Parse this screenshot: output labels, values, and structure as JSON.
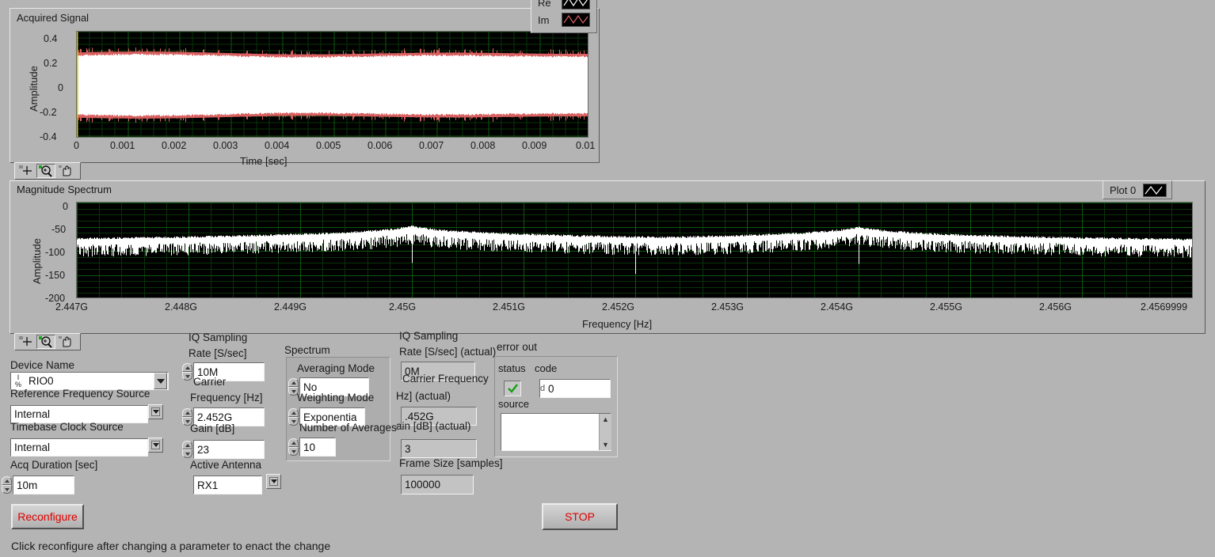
{
  "signal_graph": {
    "title": "Acquired Signal",
    "y_title": "Amplitude",
    "x_title": "Time [sec]",
    "y_ticks": [
      "0.4",
      "0.2",
      "0",
      "-0.2",
      "-0.4"
    ],
    "x_ticks": [
      "0",
      "0.001",
      "0.002",
      "0.003",
      "0.004",
      "0.005",
      "0.006",
      "0.007",
      "0.008",
      "0.009",
      "0.01"
    ],
    "legend": [
      {
        "name": "Re",
        "color": "#ffffff"
      },
      {
        "name": "Im",
        "color": "#d86060"
      }
    ]
  },
  "spectrum_graph": {
    "title": "Magnitude Spectrum",
    "y_title": "Amplitude",
    "x_title": "Frequency [Hz]",
    "y_ticks": [
      "0",
      "-50",
      "-100",
      "-150",
      "-200"
    ],
    "x_ticks": [
      "2.447G",
      "2.448G",
      "2.449G",
      "2.45G",
      "2.451G",
      "2.452G",
      "2.453G",
      "2.454G",
      "2.455G",
      "2.456G",
      "2.4569999"
    ],
    "legend": [
      {
        "name": "Plot 0",
        "color": "#ffffff"
      }
    ]
  },
  "chart_data": {
    "type": "line",
    "title": "Magnitude Spectrum",
    "xlabel": "Frequency [Hz]",
    "ylabel": "Amplitude",
    "xlim": [
      2447000000.0,
      2456999900.0
    ],
    "ylim": [
      -200,
      0
    ],
    "grid": true,
    "legend_position": "top-right",
    "series": [
      {
        "name": "Plot 0",
        "color": "#ffffff",
        "noise_floor_db": -130,
        "peaks": [
          {
            "freq": 2450000000.0,
            "level_db": -55
          },
          {
            "freq": 2452000000.0,
            "level_db": -78
          },
          {
            "freq": 2454000000.0,
            "level_db": -57
          }
        ]
      }
    ],
    "secondary_chart": {
      "type": "line",
      "title": "Acquired Signal",
      "xlabel": "Time [sec]",
      "ylabel": "Amplitude",
      "xlim": [
        0,
        0.01
      ],
      "ylim": [
        -0.4,
        0.4
      ],
      "series": [
        {
          "name": "Re",
          "color": "#ffffff",
          "envelope": [
            -0.23,
            0.23
          ]
        },
        {
          "name": "Im",
          "color": "#d86060",
          "envelope": [
            -0.26,
            0.26
          ]
        }
      ]
    }
  },
  "tools": {
    "cursor": "crosshair-cursor-tool",
    "zoom": "zoom-tool",
    "pan": "pan-hand-tool"
  },
  "controls": {
    "device_name": {
      "label": "Device Name",
      "value": "RIO0"
    },
    "ref_freq_source": {
      "label": "Reference Frequency Source",
      "value": "Internal"
    },
    "timebase_clock_source": {
      "label": "Timebase Clock Source",
      "value": "Internal"
    },
    "acq_duration": {
      "label": "Acq Duration [sec]",
      "value": "10m"
    },
    "iq_rate": {
      "label_line1": "IQ Sampling",
      "label_line2": "Rate [S/sec]",
      "value": "10M"
    },
    "carrier_freq": {
      "label_line1": "Carrier",
      "label_line2": "Frequency [Hz]",
      "value": "2.452G"
    },
    "gain": {
      "label": "Gain [dB]",
      "value": "23"
    },
    "active_antenna": {
      "label": "Active Antenna",
      "value": "RX1"
    }
  },
  "spectrum_group": {
    "title": "Spectrum",
    "averaging_mode": {
      "label": "Averaging Mode",
      "value": "No"
    },
    "weighting_mode": {
      "label": "Weighting Mode",
      "value": "Exponentia"
    },
    "number_of_averages": {
      "label": "Number of Averages",
      "value": "10"
    }
  },
  "actuals": {
    "iq_rate_actual": {
      "label_line1": "IQ Sampling",
      "label_line2": "Rate [S/sec] (actual)",
      "value": "0M"
    },
    "carrier_freq_actual": {
      "label_line1": "Carrier Frequency",
      "label_line2": "Hz] (actual)",
      "value": ".452G"
    },
    "gain_actual": {
      "label": "ain [dB] (actual)",
      "value": "3"
    },
    "frame_size": {
      "label": "Frame Size [samples]",
      "value": "100000"
    }
  },
  "error_out": {
    "title": "error out",
    "status_label": "status",
    "code_label": "code",
    "code_value": "0",
    "code_prefix": "d",
    "source_label": "source",
    "source_value": "",
    "status_ok": true
  },
  "buttons": {
    "reconfigure": "Reconfigure",
    "stop": "STOP"
  },
  "hint": "Click reconfigure after changing a parameter to enact the change",
  "colors": {
    "panel_bg": "#b4b4b4",
    "plot_bg": "#000000",
    "grid": "#0d4d0d",
    "trace_white": "#ffffff",
    "trace_red": "#d86060",
    "accent_red": "#e00000",
    "cursor_yellow": "#c8c800"
  }
}
